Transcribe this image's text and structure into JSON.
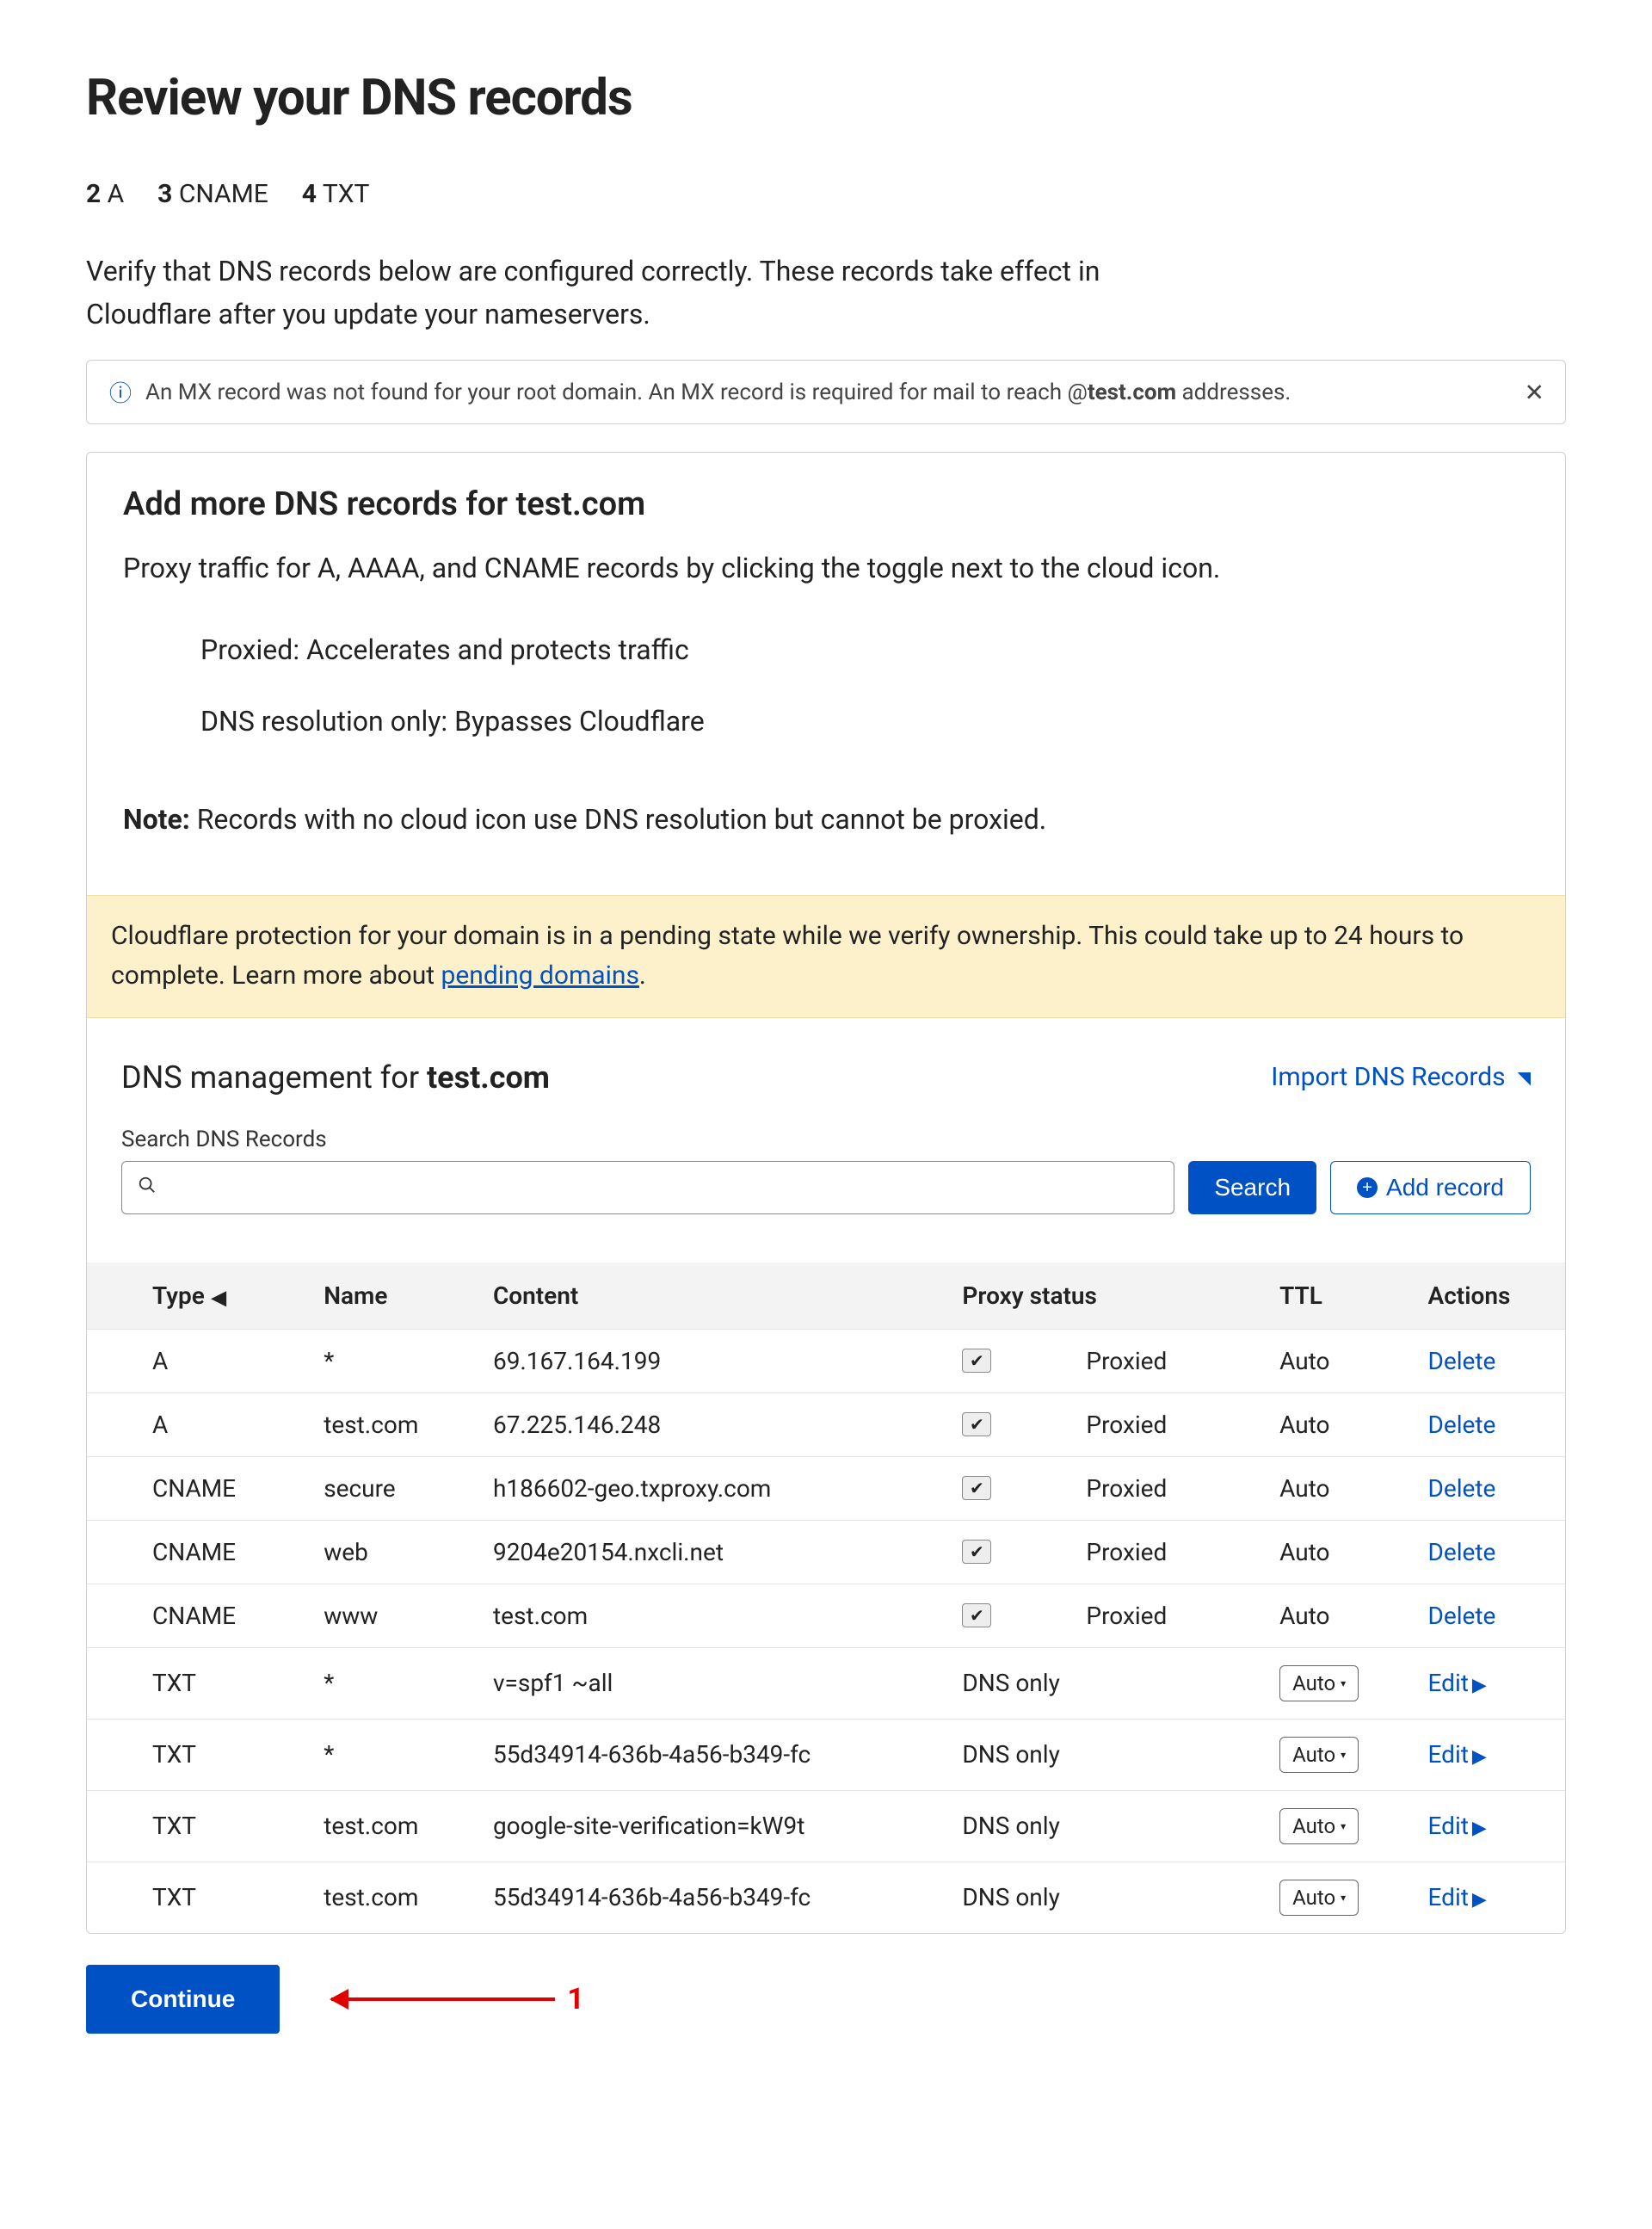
{
  "page": {
    "title": "Review your DNS records",
    "counts": {
      "a": "2",
      "a_label": "A",
      "cname": "3",
      "cname_label": "CNAME",
      "txt": "4",
      "txt_label": "TXT"
    },
    "intro": "Verify that DNS records below are configured correctly. These records take effect in Cloudflare after you update your nameservers.",
    "mx_alert_prefix": "An MX record was not found for your root domain. An MX record is required for mail to reach @",
    "mx_alert_domain": "test.com",
    "mx_alert_suffix": " addresses."
  },
  "add_section": {
    "heading": "Add more DNS records for test.com",
    "para1": "Proxy traffic for A, AAAA, and CNAME records by clicking the toggle next to the cloud icon.",
    "bullet1": "Proxied: Accelerates and protects traffic",
    "bullet2": "DNS resolution only: Bypasses Cloudflare",
    "note_label": "Note:",
    "note_text": " Records with no cloud icon use DNS resolution but cannot be proxied."
  },
  "warning": {
    "text_before": "Cloudflare protection for your domain is in a pending state while we verify ownership. This could take up to 24 hours to complete. Learn more about ",
    "link_text": "pending domains",
    "text_after": "."
  },
  "mgmt": {
    "heading_prefix": "DNS management for ",
    "heading_domain": "test.com",
    "import_label": "Import DNS Records",
    "search_label": "Search DNS Records",
    "search_btn": "Search",
    "add_btn": "Add record"
  },
  "table": {
    "headers": {
      "type": "Type",
      "name": "Name",
      "content": "Content",
      "proxy": "Proxy status",
      "ttl": "TTL",
      "actions": "Actions"
    },
    "proxied_label": "Proxied",
    "dnsonly_label": "DNS only",
    "ttl_auto": "Auto",
    "delete_label": "Delete",
    "edit_label": "Edit",
    "rows": [
      {
        "type": "A",
        "name": "*",
        "content": "69.167.164.199",
        "proxy": "proxied",
        "ttl_pill": false,
        "action": "delete"
      },
      {
        "type": "A",
        "name": "test.com",
        "content": "67.225.146.248",
        "proxy": "proxied",
        "ttl_pill": false,
        "action": "delete"
      },
      {
        "type": "CNAME",
        "name": "secure",
        "content": "h186602-geo.txproxy.com",
        "proxy": "proxied",
        "ttl_pill": false,
        "action": "delete"
      },
      {
        "type": "CNAME",
        "name": "web",
        "content": "9204e20154.nxcli.net",
        "proxy": "proxied",
        "ttl_pill": false,
        "action": "delete"
      },
      {
        "type": "CNAME",
        "name": "www",
        "content": "test.com",
        "proxy": "proxied",
        "ttl_pill": false,
        "action": "delete"
      },
      {
        "type": "TXT",
        "name": "*",
        "content": "v=spf1 ~all",
        "proxy": "dnsonly",
        "ttl_pill": true,
        "action": "edit"
      },
      {
        "type": "TXT",
        "name": "*",
        "content": "55d34914-636b-4a56-b349-fc",
        "proxy": "dnsonly",
        "ttl_pill": true,
        "action": "edit"
      },
      {
        "type": "TXT",
        "name": "test.com",
        "content": "google-site-verification=kW9t",
        "proxy": "dnsonly",
        "ttl_pill": true,
        "action": "edit"
      },
      {
        "type": "TXT",
        "name": "test.com",
        "content": "55d34914-636b-4a56-b349-fc",
        "proxy": "dnsonly",
        "ttl_pill": true,
        "action": "edit"
      }
    ]
  },
  "footer": {
    "continue": "Continue",
    "annotation_number": "1"
  }
}
